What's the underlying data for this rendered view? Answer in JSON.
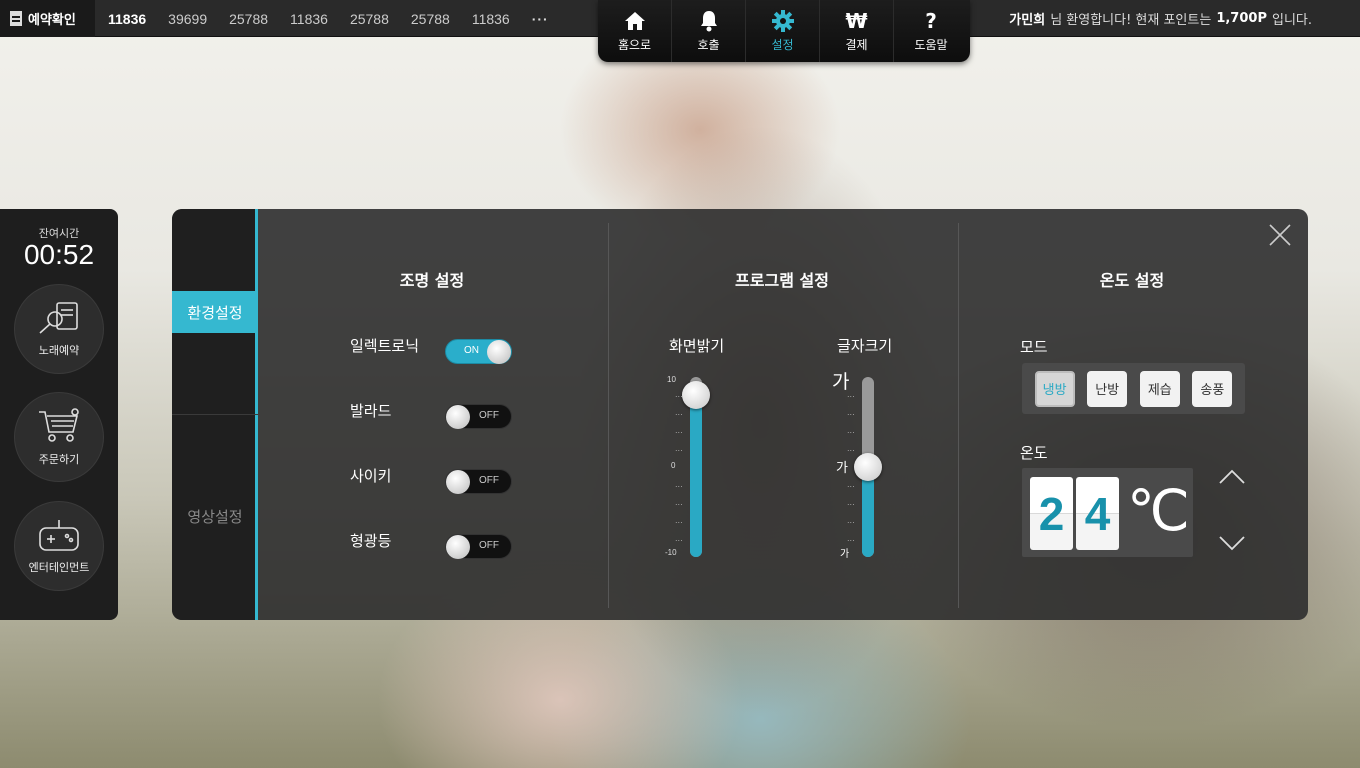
{
  "topbar": {
    "reserve_label": "예약확인",
    "queue": [
      "11836",
      "39699",
      "25788",
      "11836",
      "25788",
      "25788",
      "11836"
    ],
    "more": "···",
    "greeting": {
      "name": "가민희",
      "mid": "님 환영합니다! 현재 포인트는",
      "points": "1,700P",
      "tail": "입니다."
    }
  },
  "nav": {
    "items": [
      {
        "label": "홈으로",
        "icon": "home-icon"
      },
      {
        "label": "호출",
        "icon": "bell-icon"
      },
      {
        "label": "설정",
        "icon": "gear-icon",
        "active": true
      },
      {
        "label": "결제",
        "icon": "won-icon",
        "glyph": "₩"
      },
      {
        "label": "도움말",
        "icon": "help-icon",
        "glyph": "?"
      }
    ]
  },
  "left": {
    "remain_label": "잔여시간",
    "remain_time": "00:52",
    "buttons": [
      {
        "label": "노래예약",
        "icon": "song-reserve-icon"
      },
      {
        "label": "주문하기",
        "icon": "cart-icon"
      },
      {
        "label": "엔터테인먼트",
        "icon": "gamepad-icon"
      }
    ]
  },
  "subnav": {
    "env": "환경설정",
    "video": "영상설정"
  },
  "lighting": {
    "title": "조명 설정",
    "items": [
      {
        "label": "일렉트로닉",
        "state": "ON"
      },
      {
        "label": "발라드",
        "state": "OFF"
      },
      {
        "label": "사이키",
        "state": "OFF"
      },
      {
        "label": "형광등",
        "state": "OFF"
      }
    ]
  },
  "program": {
    "title": "프로그램 설정",
    "brightness": {
      "label": "화면밝기",
      "max": "10",
      "mid": "0",
      "min": "-10",
      "value": 8,
      "range": [
        -10,
        10
      ]
    },
    "fontsize": {
      "label": "글자크기",
      "big": "가",
      "mid": "가",
      "small": "가",
      "level": 0.5
    }
  },
  "temperature": {
    "title": "온도 설정",
    "mode_label": "모드",
    "modes": [
      "냉방",
      "난방",
      "제습",
      "송풍"
    ],
    "active_mode": "냉방",
    "temp_label": "온도",
    "digit1": "2",
    "digit2": "4",
    "unit": "℃"
  },
  "colors": {
    "accent": "#35b8d0",
    "toggle_on": "#2aaecb"
  }
}
